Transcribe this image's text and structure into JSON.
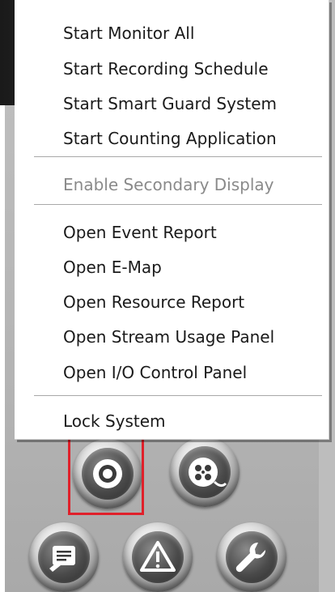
{
  "menu": {
    "group1": [
      {
        "label": "Start Monitor All"
      },
      {
        "label": "Start Recording Schedule"
      },
      {
        "label": "Start Smart Guard System"
      },
      {
        "label": "Start Counting Application"
      }
    ],
    "group2": [
      {
        "label": "Enable Secondary Display",
        "disabled": true
      }
    ],
    "group3": [
      {
        "label": "Open Event Report"
      },
      {
        "label": "Open E-Map"
      },
      {
        "label": "Open Resource Report"
      },
      {
        "label": "Open Stream Usage Panel"
      },
      {
        "label": "Open I/O Control Panel"
      }
    ],
    "group4": [
      {
        "label": "Lock System"
      }
    ]
  },
  "buttons": {
    "record": {
      "icon": "record-icon"
    },
    "playback": {
      "icon": "film-reel-icon"
    },
    "log": {
      "icon": "log-viewer-icon"
    },
    "alarm": {
      "icon": "warning-triangle-icon"
    },
    "settings": {
      "icon": "wrench-icon"
    }
  },
  "colors": {
    "highlight": "#e0202a",
    "menu_bg": "#ffffff",
    "disabled_text": "#8a8a8a"
  }
}
